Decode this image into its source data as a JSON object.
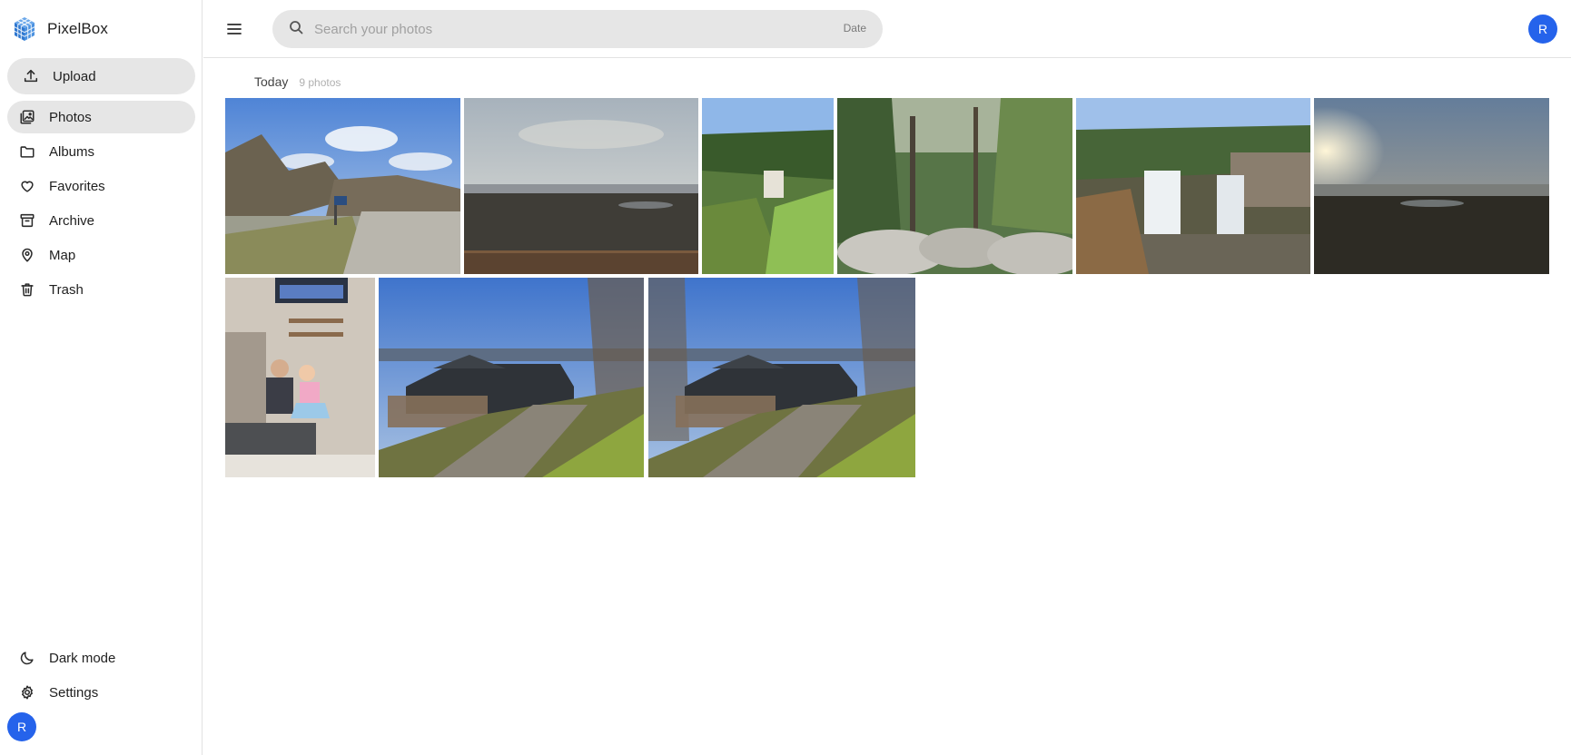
{
  "app": {
    "name": "PixelBox"
  },
  "sidebar": {
    "upload_label": "Upload",
    "items": [
      {
        "label": "Photos",
        "icon": "photos-icon",
        "active": true
      },
      {
        "label": "Albums",
        "icon": "folder-icon"
      },
      {
        "label": "Favorites",
        "icon": "heart-icon"
      },
      {
        "label": "Archive",
        "icon": "archive-icon"
      },
      {
        "label": "Map",
        "icon": "map-pin-icon"
      },
      {
        "label": "Trash",
        "icon": "trash-icon"
      }
    ],
    "bottom": [
      {
        "label": "Dark mode",
        "icon": "moon-icon"
      },
      {
        "label": "Settings",
        "icon": "gear-icon"
      }
    ],
    "avatar_initial": "R"
  },
  "header": {
    "search_placeholder": "Search your photos",
    "search_filter": "Date",
    "avatar_initial": "R"
  },
  "gallery": {
    "section_label": "Today",
    "section_count": "9 photos",
    "photos": [
      {
        "subject": "gravel road with bare trees under blue sky"
      },
      {
        "subject": "overcast overlook above forest valley"
      },
      {
        "subject": "waterfall in green forest"
      },
      {
        "subject": "trees growing over rocks"
      },
      {
        "subject": "waterfall over rock ledge"
      },
      {
        "subject": "sunset over hazy valley"
      },
      {
        "subject": "children in living room"
      },
      {
        "subject": "dark house with deck on hillside"
      },
      {
        "subject": "dark house with deck on hillside"
      }
    ]
  },
  "colors": {
    "accent": "#2563eb",
    "selected_bg": "#e6e6e6"
  }
}
